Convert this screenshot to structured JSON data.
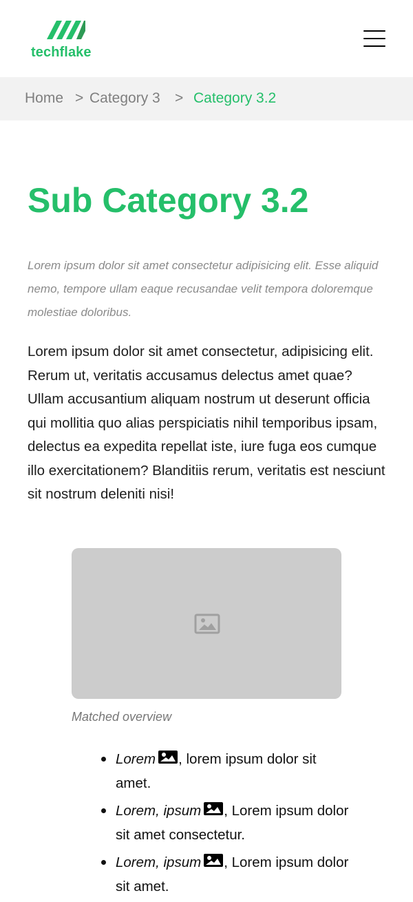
{
  "header": {
    "logo": {
      "text": "techflake",
      "icon": "techflake-logo-mark-icon"
    },
    "menu_icon": "hamburger-menu-icon"
  },
  "breadcrumb": {
    "separator": ">",
    "items": [
      {
        "label": "Home"
      },
      {
        "label": "Category 3"
      },
      {
        "label": "Category 3.2"
      }
    ]
  },
  "main": {
    "title": "Sub Category 3.2",
    "lead": "Lorem ipsum dolor sit amet consectetur adipisicing elit. Esse aliquid nemo, tempore ullam eaque recusandae velit tempora doloremque molestiae doloribus.",
    "body": "Lorem ipsum dolor sit amet consectetur, adipisicing elit. Rerum ut, veritatis accusamus delectus amet quae? Ullam accusantium aliquam nostrum ut deserunt officia qui mollitia quo alias perspiciatis nihil temporibus ipsam, delectus ea expedita repellat iste, iure fuga eos cumque illo exercitationem? Blanditiis rerum, veritatis est nesciunt sit nostrum deleniti nisi!",
    "figure": {
      "icon": "image-placeholder-icon",
      "caption": "Matched overview"
    },
    "list": [
      {
        "term": "Lorem",
        "icon": "image-icon",
        "text": ", lorem ipsum dolor sit amet."
      },
      {
        "term": "Lorem, ipsum",
        "icon": "image-icon",
        "text": ", Lorem ipsum dolor sit amet consectetur."
      },
      {
        "term": "Lorem, ipsum",
        "icon": "image-icon",
        "text": ", Lorem ipsum dolor sit amet."
      }
    ]
  },
  "colors": {
    "brand_green": "#25bf6a",
    "breadcrumb_background": "#f2f2f2",
    "muted_text": "#8a8a8a",
    "placeholder_gray": "#cccccc"
  }
}
